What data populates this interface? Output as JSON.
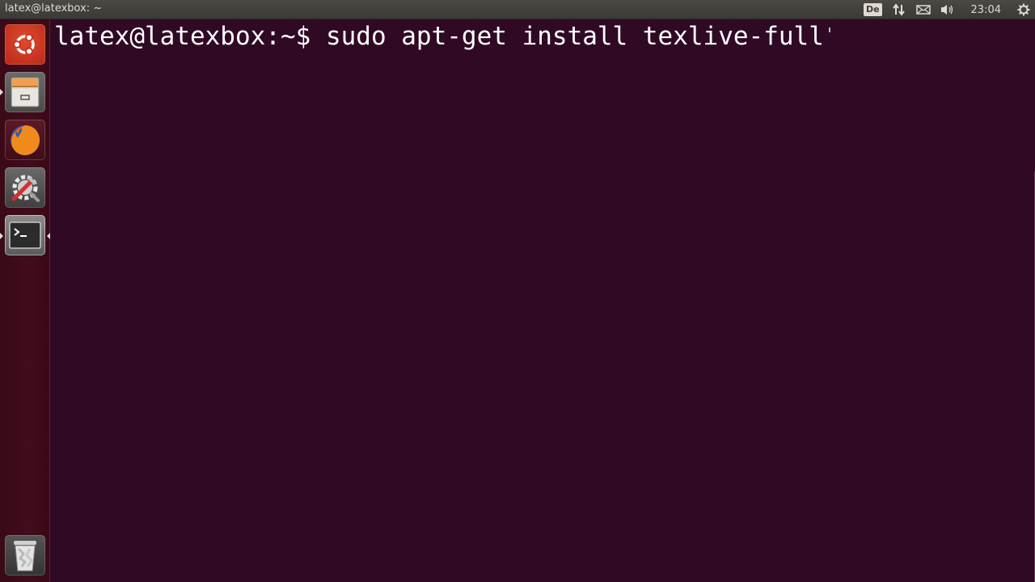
{
  "top_panel": {
    "window_title": "latex@latexbox: ~",
    "keyboard_layout": "De",
    "clock": "23:04",
    "indicators": [
      "keyboard-layout-icon",
      "network-icon",
      "mail-icon",
      "volume-icon",
      "session-gear-icon"
    ]
  },
  "launcher": {
    "items": [
      {
        "name": "ubuntu-dash",
        "icon": "ubuntu-logo-icon"
      },
      {
        "name": "files",
        "icon": "file-cabinet-icon"
      },
      {
        "name": "firefox",
        "icon": "firefox-icon"
      },
      {
        "name": "system-settings",
        "icon": "settings-tools-icon"
      },
      {
        "name": "terminal",
        "icon": "terminal-icon"
      },
      {
        "name": "trash",
        "icon": "trash-icon"
      }
    ]
  },
  "terminal": {
    "prompt": "latex@latexbox:~$",
    "command": "sudo apt-get install texlive-full",
    "background": "#300a24",
    "foreground": "#ffffff"
  }
}
